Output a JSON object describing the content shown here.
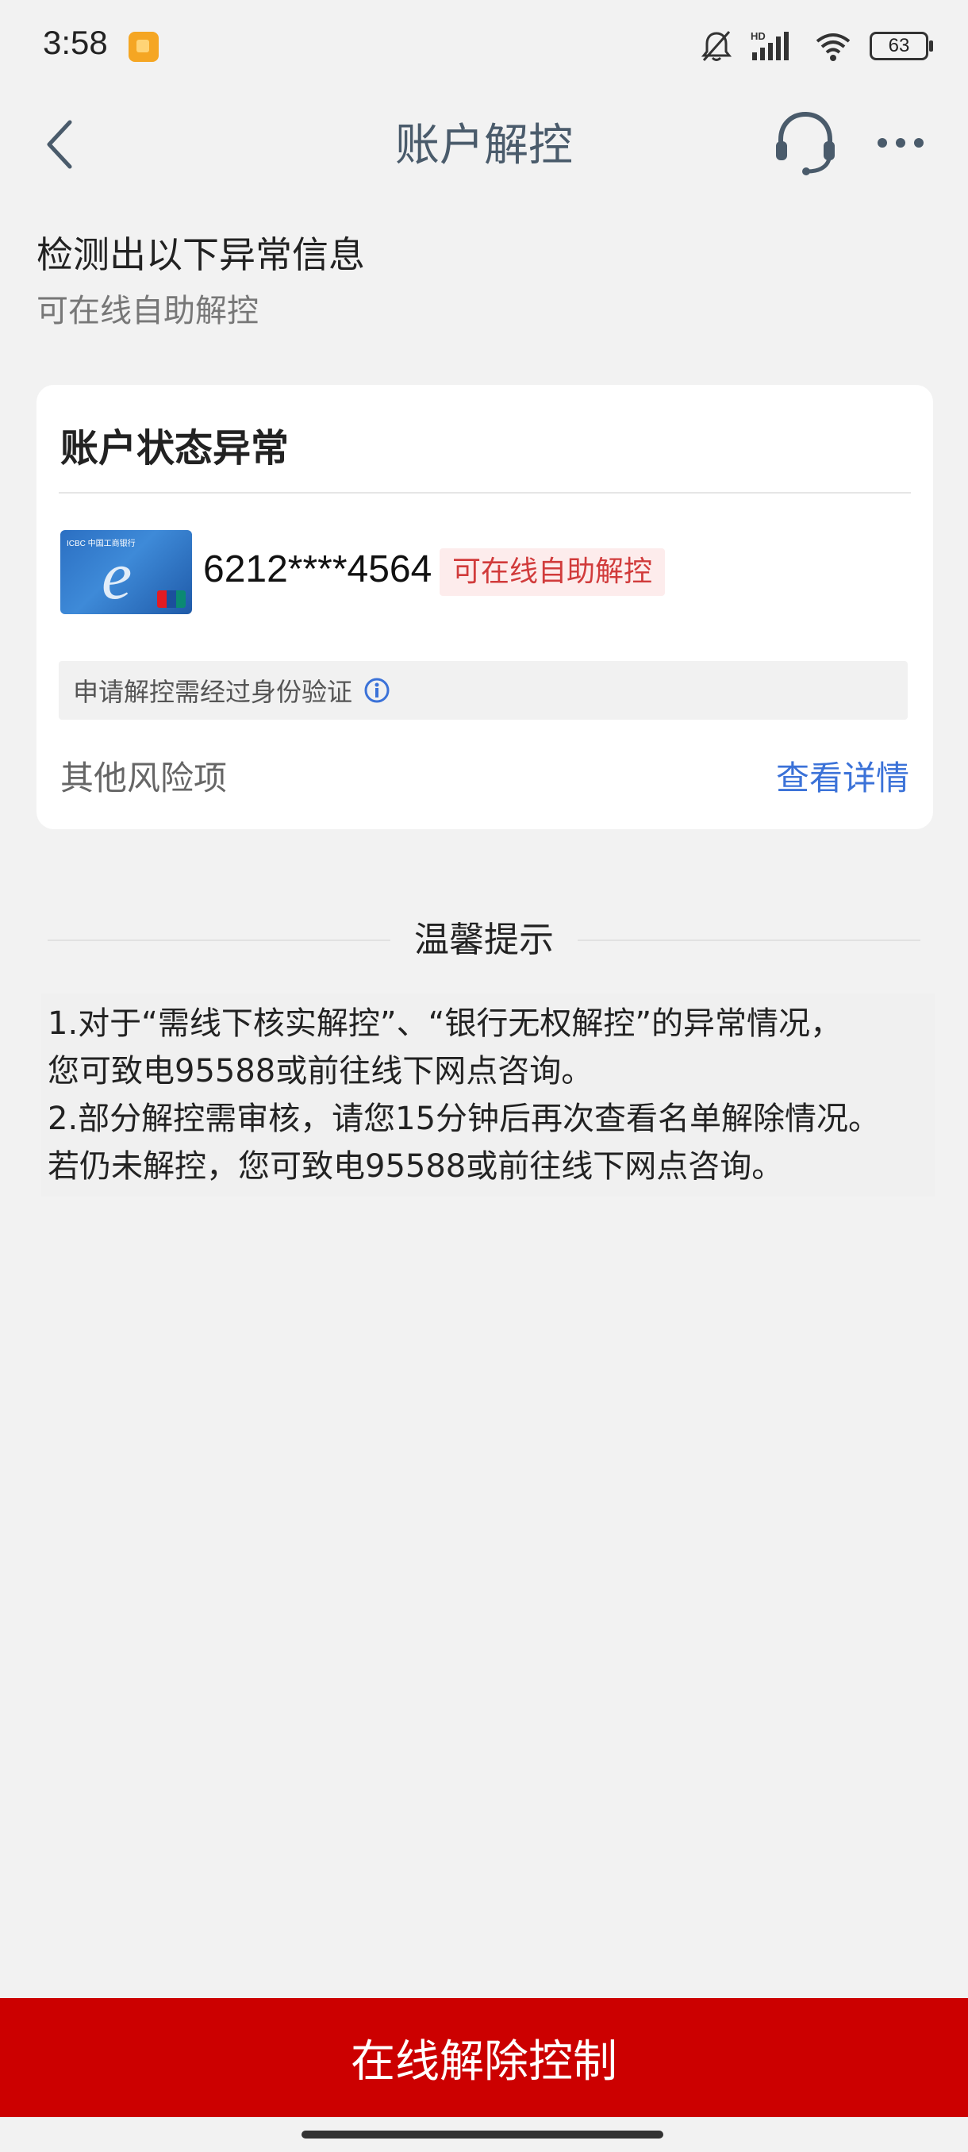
{
  "status_bar": {
    "time": "3:58",
    "battery": "63",
    "icons": [
      "notification-app-icon",
      "mute-bell-icon",
      "hd-signal-icon",
      "wifi-icon",
      "battery-icon"
    ]
  },
  "nav": {
    "title": "账户解控",
    "back_icon": "chevron-left-icon",
    "service_icon": "headset-icon",
    "more_icon": "more-dots-icon"
  },
  "header": {
    "title": "检测出以下异常信息",
    "subtitle": "可在线自助解控"
  },
  "card": {
    "title": "账户状态异常",
    "card_number": "6212****4564",
    "badge": "可在线自助解控",
    "verify_notice": "申请解控需经过身份验证",
    "other_risk_label": "其他风险项",
    "view_details": "查看详情"
  },
  "tips": {
    "title": "温馨提示",
    "lines": [
      "1.对于“需线下核实解控”、“银行无权解控”的异常情况，",
      "您可致电95588或前往线下网点咨询。",
      "2.部分解控需审核，请您15分钟后再次查看名单解除情况。",
      "若仍未解控，您可致电95588或前往线下网点咨询。"
    ]
  },
  "bottom_button": "在线解除控制",
  "colors": {
    "primary_red": "#cc0000",
    "link_blue": "#3b72d8",
    "badge_text": "#d13b3b",
    "badge_bg": "#fdecec",
    "background": "#f2f2f2"
  }
}
